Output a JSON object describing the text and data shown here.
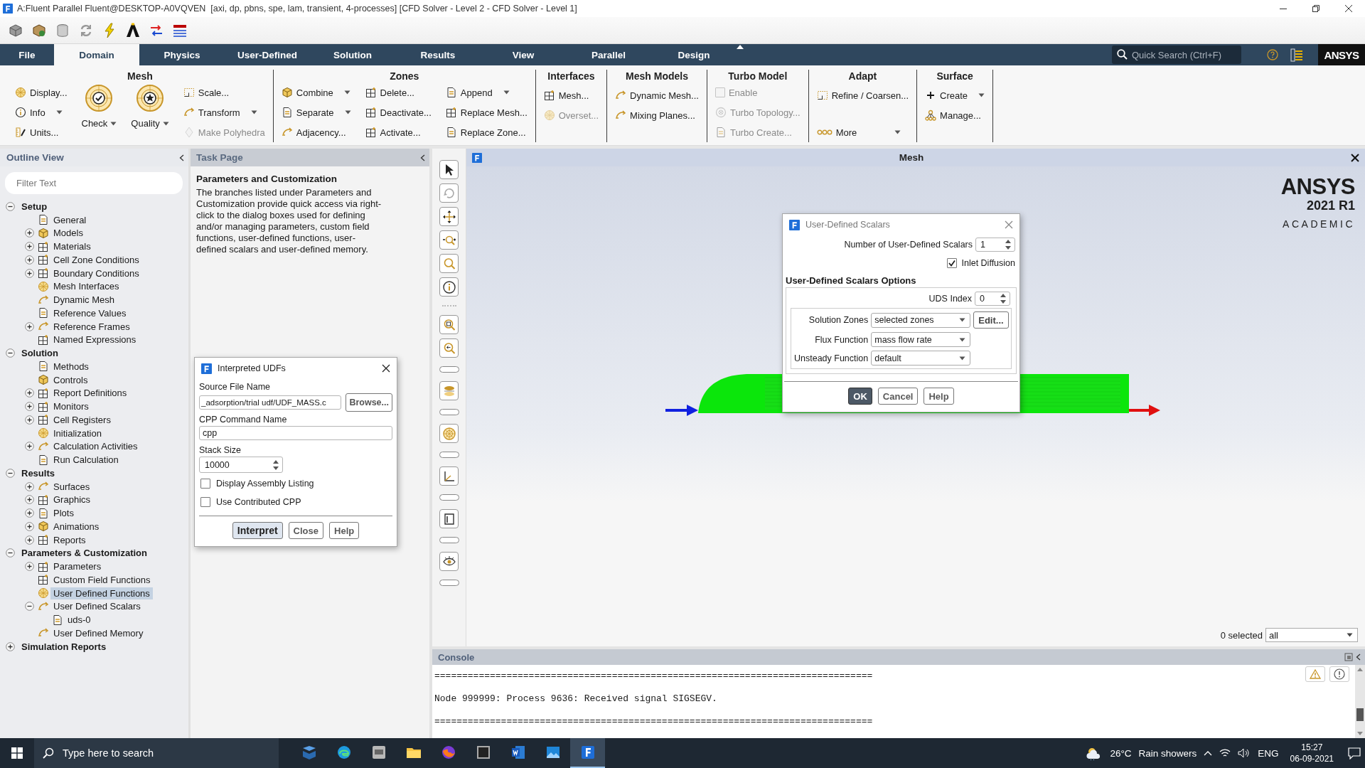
{
  "window": {
    "title": "A:Fluent Parallel Fluent@DESKTOP-A0VQVEN  [axi, dp, pbns, spe, lam, transient, 4-processes] [CFD Solver - Level 2 - CFD Solver - Level 1]"
  },
  "tabs": [
    {
      "label": "File",
      "selected": false
    },
    {
      "label": "Domain",
      "selected": true
    },
    {
      "label": "Physics",
      "selected": false
    },
    {
      "label": "User-Defined",
      "selected": false
    },
    {
      "label": "Solution",
      "selected": false
    },
    {
      "label": "Results",
      "selected": false
    },
    {
      "label": "View",
      "selected": false
    },
    {
      "label": "Parallel",
      "selected": false
    },
    {
      "label": "Design",
      "selected": false
    }
  ],
  "quick_search": {
    "placeholder": "Quick Search (Ctrl+F)"
  },
  "brand": "ANSYS",
  "ribbon": {
    "groups": [
      {
        "title": "Mesh",
        "columns": [
          [
            {
              "kind": "button",
              "label": "Display...",
              "disabled": false,
              "dropdown": false
            },
            {
              "kind": "button",
              "label": "Info",
              "disabled": false,
              "dropdown": true
            },
            {
              "kind": "button",
              "label": "Units...",
              "disabled": false,
              "dropdown": false
            }
          ],
          [
            {
              "kind": "large",
              "label": "Check",
              "disabled": false,
              "dropdown": true
            }
          ],
          [
            {
              "kind": "large",
              "label": "Quality",
              "disabled": false,
              "dropdown": true
            }
          ],
          [
            {
              "kind": "button",
              "label": "Scale...",
              "disabled": false,
              "dropdown": false
            },
            {
              "kind": "button",
              "label": "Transform",
              "disabled": false,
              "dropdown": true
            },
            {
              "kind": "button",
              "label": "Make Polyhedra",
              "disabled": true,
              "dropdown": false
            }
          ]
        ]
      },
      {
        "title": "Zones",
        "columns": [
          [
            {
              "kind": "button",
              "label": "Combine",
              "disabled": false,
              "dropdown": true
            },
            {
              "kind": "button",
              "label": "Separate",
              "disabled": false,
              "dropdown": true
            },
            {
              "kind": "button",
              "label": "Adjacency...",
              "disabled": false,
              "dropdown": false
            }
          ],
          [
            {
              "kind": "button",
              "label": "Delete...",
              "disabled": false,
              "dropdown": false
            },
            {
              "kind": "button",
              "label": "Deactivate...",
              "disabled": false,
              "dropdown": false
            },
            {
              "kind": "button",
              "label": "Activate...",
              "disabled": false,
              "dropdown": false
            }
          ],
          [
            {
              "kind": "button",
              "label": "Append",
              "disabled": false,
              "dropdown": true
            },
            {
              "kind": "button",
              "label": "Replace Mesh...",
              "disabled": false,
              "dropdown": false
            },
            {
              "kind": "button",
              "label": "Replace Zone...",
              "disabled": false,
              "dropdown": false
            }
          ]
        ]
      },
      {
        "title": "Interfaces",
        "columns": [
          [
            {
              "kind": "button",
              "label": "Mesh...",
              "disabled": false,
              "dropdown": false
            },
            {
              "kind": "button",
              "label": "Overset...",
              "disabled": true,
              "dropdown": false
            }
          ]
        ]
      },
      {
        "title": "Mesh Models",
        "columns": [
          [
            {
              "kind": "button",
              "label": "Dynamic Mesh...",
              "disabled": false,
              "dropdown": false
            },
            {
              "kind": "button",
              "label": "Mixing Planes...",
              "disabled": false,
              "dropdown": false
            }
          ]
        ]
      },
      {
        "title": "Turbo Model",
        "columns": [
          [
            {
              "kind": "checkbox",
              "label": "Enable",
              "disabled": true,
              "checked": false
            },
            {
              "kind": "button",
              "label": "Turbo Topology...",
              "disabled": true,
              "dropdown": false
            },
            {
              "kind": "button",
              "label": "Turbo Create...",
              "disabled": true,
              "dropdown": false
            }
          ]
        ]
      },
      {
        "title": "Adapt",
        "columns": [
          [
            {
              "kind": "button",
              "label": "Refine / Coarsen...",
              "disabled": false,
              "dropdown": false
            },
            {
              "kind": "more",
              "label": "More",
              "disabled": false,
              "dropdown": true
            }
          ]
        ]
      },
      {
        "title": "Surface",
        "columns": [
          [
            {
              "kind": "button",
              "label": "Create",
              "disabled": false,
              "dropdown": true
            },
            {
              "kind": "button",
              "label": "Manage...",
              "disabled": false,
              "dropdown": false
            }
          ]
        ]
      }
    ]
  },
  "outline": {
    "title": "Outline View",
    "filter": {
      "placeholder": "Filter Text"
    },
    "tree": [
      {
        "label": "Setup",
        "selected": false,
        "expanded": true,
        "children": [
          {
            "label": "General",
            "selected": false
          },
          {
            "label": "Models",
            "selected": false,
            "expanded": false
          },
          {
            "label": "Materials",
            "selected": false,
            "expanded": false
          },
          {
            "label": "Cell Zone Conditions",
            "selected": false,
            "expanded": false
          },
          {
            "label": "Boundary Conditions",
            "selected": false,
            "expanded": false
          },
          {
            "label": "Mesh Interfaces",
            "selected": false
          },
          {
            "label": "Dynamic Mesh",
            "selected": false
          },
          {
            "label": "Reference Values",
            "selected": false
          },
          {
            "label": "Reference Frames",
            "selected": false,
            "expanded": false
          },
          {
            "label": "Named Expressions",
            "selected": false
          }
        ]
      },
      {
        "label": "Solution",
        "selected": false,
        "expanded": true,
        "children": [
          {
            "label": "Methods",
            "selected": false
          },
          {
            "label": "Controls",
            "selected": false
          },
          {
            "label": "Report Definitions",
            "selected": false,
            "expanded": false
          },
          {
            "label": "Monitors",
            "selected": false,
            "expanded": false
          },
          {
            "label": "Cell Registers",
            "selected": false,
            "expanded": false
          },
          {
            "label": "Initialization",
            "selected": false
          },
          {
            "label": "Calculation Activities",
            "selected": false,
            "expanded": false
          },
          {
            "label": "Run Calculation",
            "selected": false
          }
        ]
      },
      {
        "label": "Results",
        "selected": false,
        "expanded": true,
        "children": [
          {
            "label": "Surfaces",
            "selected": false,
            "expanded": false
          },
          {
            "label": "Graphics",
            "selected": false,
            "expanded": false
          },
          {
            "label": "Plots",
            "selected": false,
            "expanded": false
          },
          {
            "label": "Animations",
            "selected": false,
            "expanded": false
          },
          {
            "label": "Reports",
            "selected": false,
            "expanded": false
          }
        ]
      },
      {
        "label": "Parameters & Customization",
        "selected": false,
        "expanded": true,
        "children": [
          {
            "label": "Parameters",
            "selected": false,
            "expanded": false
          },
          {
            "label": "Custom Field Functions",
            "selected": false
          },
          {
            "label": "User Defined Functions",
            "selected": true
          },
          {
            "label": "User Defined Scalars",
            "selected": false,
            "expanded": true,
            "children": [
              {
                "label": "uds-0",
                "selected": false
              }
            ]
          },
          {
            "label": "User Defined Memory",
            "selected": false
          }
        ]
      },
      {
        "label": "Simulation Reports",
        "selected": false,
        "expanded": false
      }
    ]
  },
  "task_page": {
    "title": "Task Page",
    "heading": "Parameters and Customization",
    "text": "The branches listed under Parameters and Customization provide quick access via right-click to the dialog boxes used for defining and/or managing parameters, custom field functions, user-defined functions, user-defined scalars and user-defined memory."
  },
  "graphics": {
    "title": "Mesh",
    "logo": {
      "name": "ANSYS",
      "version": "2021 R1",
      "edition": "ACADEMIC"
    },
    "selection": {
      "count": "0 selected",
      "filter": "all"
    }
  },
  "console": {
    "title": "Console",
    "lines": [
      "===============================================================================",
      "Node 999999: Process 9636: Received signal SIGSEGV.",
      "==============================================================================="
    ]
  },
  "interpreted_udfs": {
    "title": "Interpreted UDFs",
    "source_file": {
      "label": "Source File Name",
      "value": "_adsorption/trial udf/UDF_MASS.c"
    },
    "browse": "Browse...",
    "cpp": {
      "label": "CPP Command Name",
      "value": "cpp"
    },
    "stack_size": {
      "label": "Stack Size",
      "value": "10000"
    },
    "options": [
      {
        "label": "Display Assembly Listing",
        "checked": false
      },
      {
        "label": "Use Contributed CPP",
        "checked": false
      }
    ],
    "buttons": [
      {
        "label": "Interpret",
        "default": true
      },
      {
        "label": "Close",
        "default": false
      },
      {
        "label": "Help",
        "default": false
      }
    ]
  },
  "user_defined_scalars": {
    "title": "User-Defined Scalars",
    "count": {
      "label": "Number of User-Defined Scalars",
      "value": "1"
    },
    "inlet_diffusion": {
      "label": "Inlet Diffusion",
      "checked": true
    },
    "section": "User-Defined Scalars Options",
    "uds_index": {
      "label": "UDS Index",
      "value": "0"
    },
    "fields": [
      {
        "label": "Solution Zones",
        "value": "selected zones"
      },
      {
        "label": "Flux Function",
        "value": "mass flow rate"
      },
      {
        "label": "Unsteady Function",
        "value": "default"
      }
    ],
    "edit": "Edit...",
    "buttons": [
      {
        "label": "OK",
        "default": true
      },
      {
        "label": "Cancel",
        "default": false
      },
      {
        "label": "Help",
        "default": false
      }
    ]
  },
  "taskbar": {
    "search": {
      "placeholder": "Type here to search"
    },
    "apps": [
      {
        "selected": false
      },
      {
        "selected": false
      },
      {
        "selected": false
      },
      {
        "selected": false
      },
      {
        "selected": false
      },
      {
        "selected": false
      },
      {
        "selected": false
      },
      {
        "selected": false
      },
      {
        "selected": true
      }
    ],
    "weather": {
      "temperature": "26°C",
      "condition": "Rain showers"
    },
    "language": "ENG",
    "time": "15:27",
    "date": "06-09-2021"
  }
}
